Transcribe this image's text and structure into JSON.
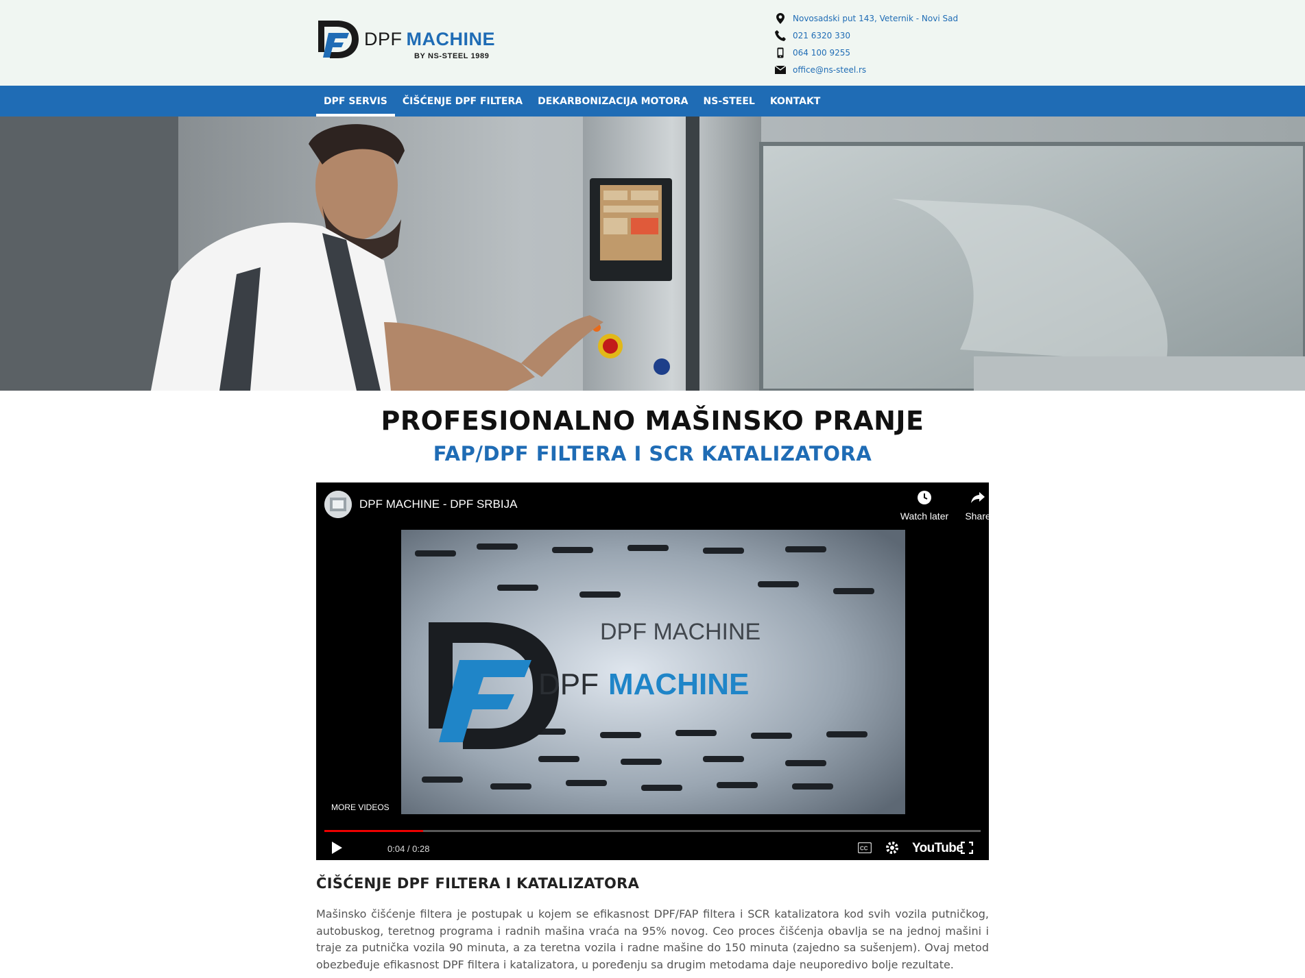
{
  "header": {
    "logo_text_dpf": "DPF",
    "logo_text_machine": "MACHINE",
    "logo_sub": "BY NS-STEEL 1989",
    "contacts": {
      "address": "Novosadski put 143, Veternik - Novi Sad",
      "phone_landline": "021 6320 330",
      "phone_mobile": "064 100 9255",
      "email": "office@ns-steel.rs"
    }
  },
  "nav": {
    "items": [
      {
        "label": "DPF SERVIS",
        "active": true
      },
      {
        "label": "ČIŠĆENJE DPF FILTERA"
      },
      {
        "label": "DEKARBONIZACIJA MOTORA"
      },
      {
        "label": "NS-STEEL"
      },
      {
        "label": "KONTAKT"
      }
    ]
  },
  "main": {
    "title": "PROFESIONALNO MAŠINSKO PRANJE",
    "subtitle": "FAP/DPF FILTERA I SCR KATALIZATORA"
  },
  "video": {
    "title": "DPF MACHINE - DPF SRBIJA",
    "watch_later": "Watch later",
    "share": "Share",
    "more_videos": "MORE VIDEOS",
    "time": "0:04 / 0:28",
    "progress": 0.15,
    "brand": "YouTube",
    "frame_logo_dpf": "DPF",
    "frame_logo_machine": "MACHINE",
    "frame_reflection": "DPF MACHINE"
  },
  "article": {
    "heading": "ČIŠĆENJE DPF FILTERA I KATALIZATORA",
    "body": "Mašinsko čišćenje filtera je postupak u kojem se efikasnost DPF/FAP filtera i SCR katalizatora kod svih vozila putničkog, autobuskog, teretnog programa i radnih mašina vraća na 95% novog. Ceo proces čišćenja obavlja se na jednoj mašini i traje za putnička vozila 90 minuta, a za teretna vozila i radne mašine do 150 minuta (zajedno sa sušenjem). Ovaj metod obezbeđuje efikasnost DPF filtera i katalizatora, u poređenju sa drugim metodama daje neuporedivo bolje rezultate."
  },
  "colors": {
    "brand_blue": "#1f6cb5",
    "header_bg": "#f0f6f2",
    "progress_red": "#ff0000"
  }
}
